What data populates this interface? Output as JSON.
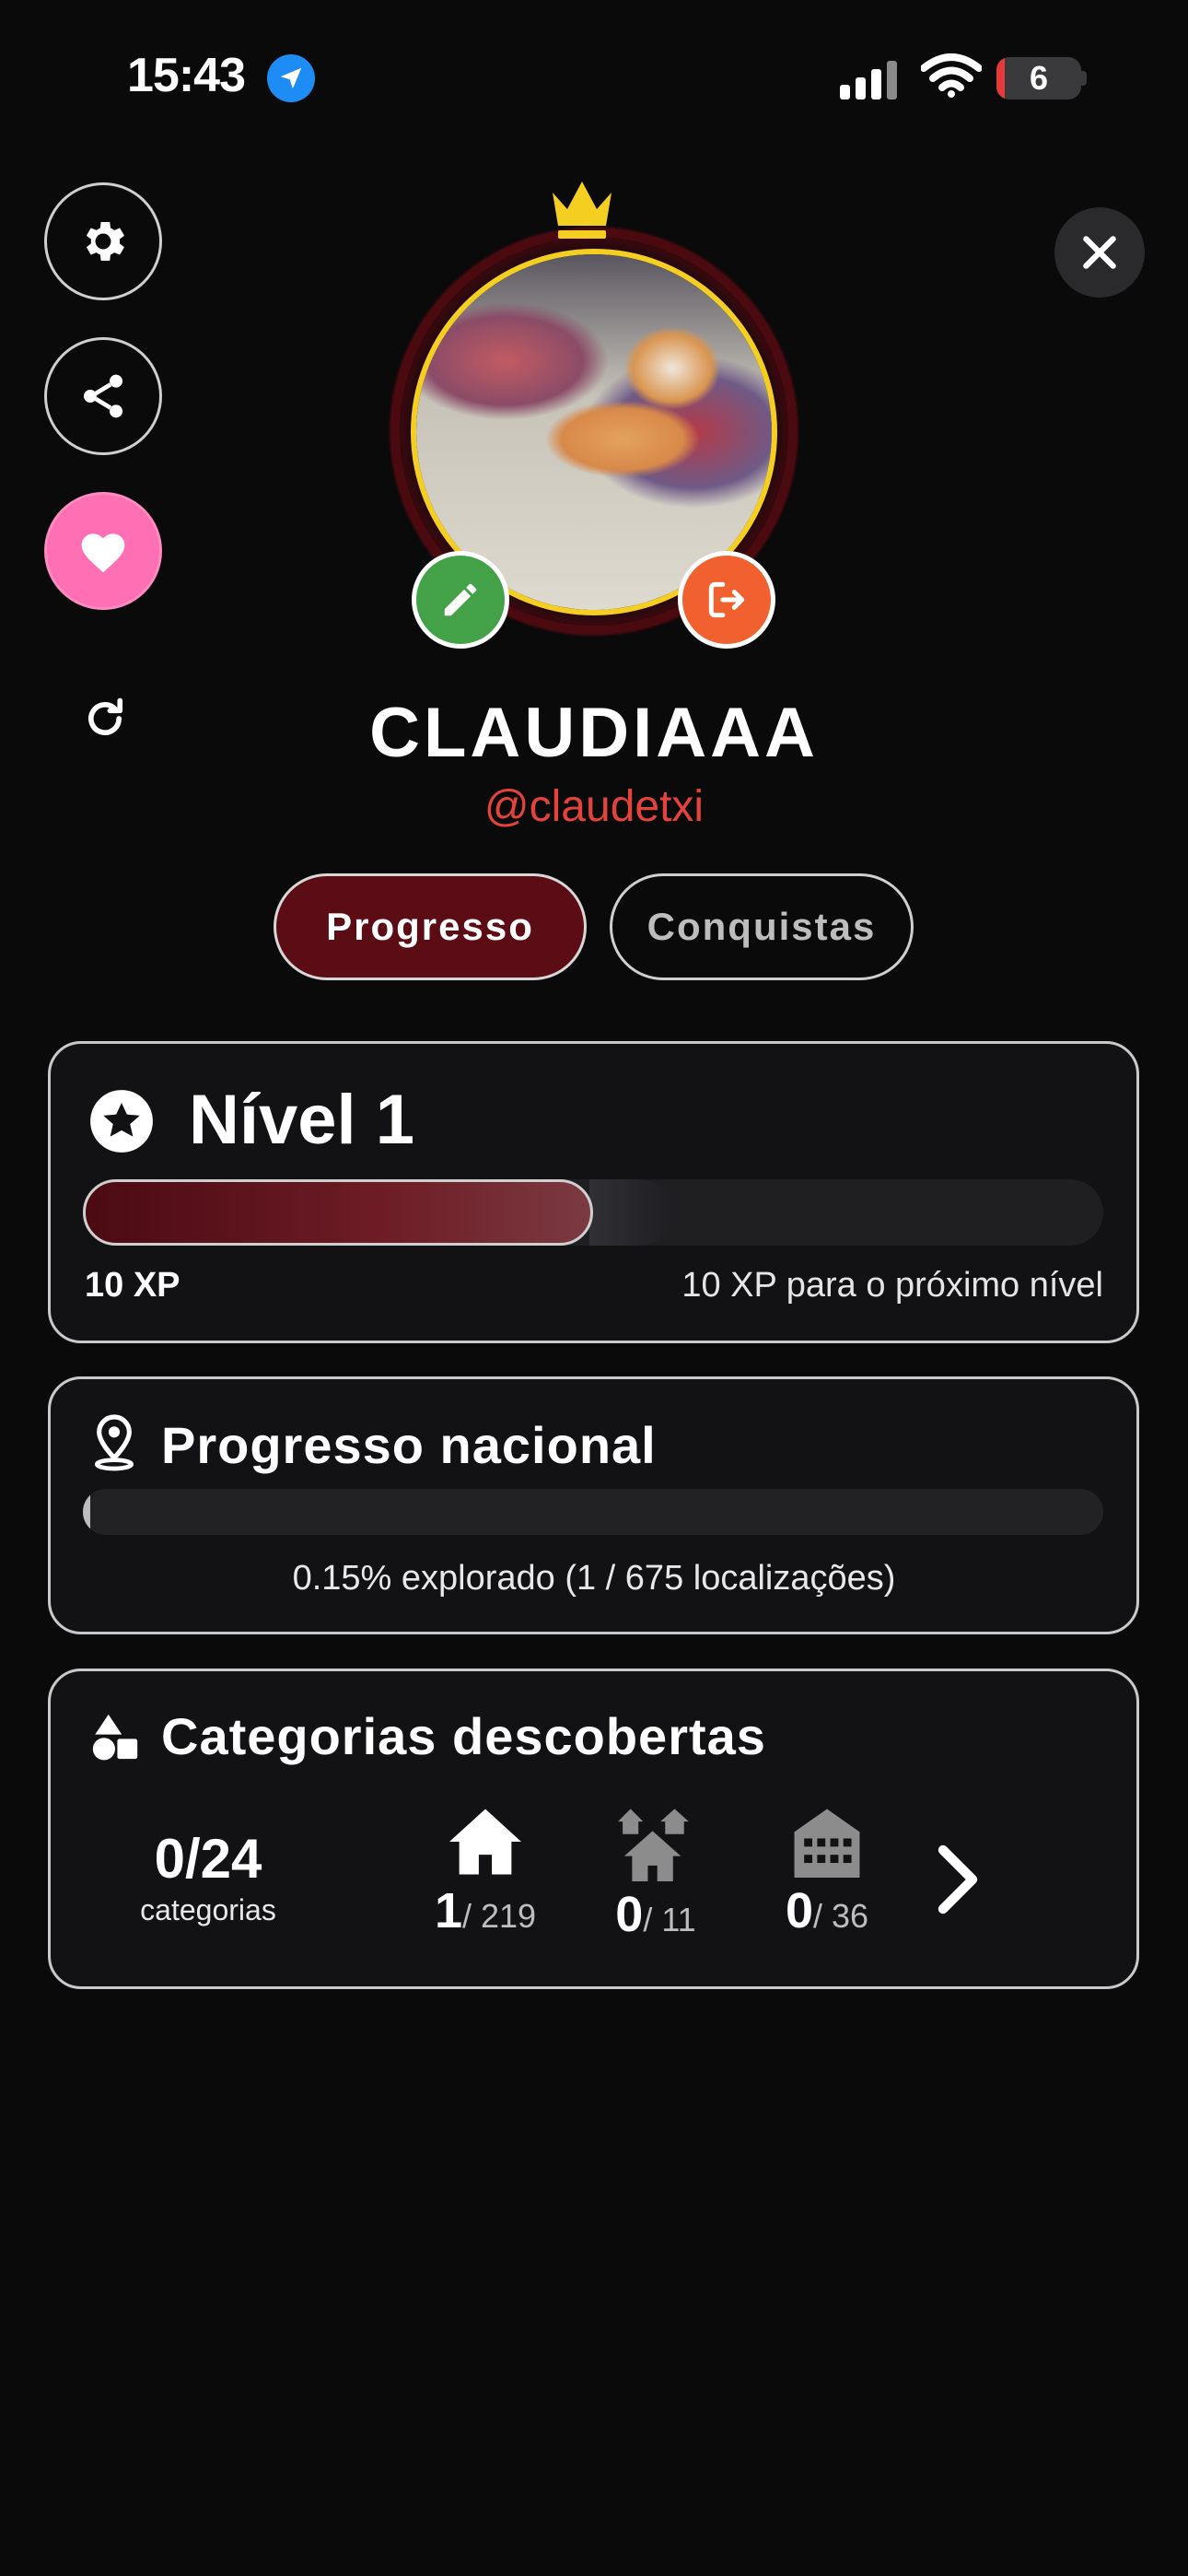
{
  "status_bar": {
    "time": "15:43",
    "battery": "6"
  },
  "profile": {
    "name": "CLAUDIAAA",
    "handle": "@claudetxi"
  },
  "tabs": [
    {
      "label": "Progresso",
      "active": true
    },
    {
      "label": "Conquistas",
      "active": false
    }
  ],
  "level": {
    "title": "Nível 1",
    "xp": "10 XP",
    "next": "10 XP para o próximo nível",
    "progress_fraction": 0.5
  },
  "national": {
    "title": "Progresso nacional",
    "summary": "0.15% explorado (1 / 675 localizações)",
    "progress_percent": 0.15
  },
  "categories": {
    "title": "Categorias descobertas",
    "count": "0/24",
    "count_label": "categorias",
    "items": [
      {
        "icon": "house-icon",
        "found": "1",
        "total": "/ 219"
      },
      {
        "icon": "houses-icon",
        "found": "0",
        "total": "/ 11"
      },
      {
        "icon": "building-icon",
        "found": "0",
        "total": "/ 36"
      }
    ]
  },
  "colors": {
    "accent": "#5c0c14",
    "handle": "#e4433b",
    "heart": "#ff6fb3",
    "edit": "#43a148",
    "logout": "#f1612f",
    "crown": "#f4cf22"
  }
}
